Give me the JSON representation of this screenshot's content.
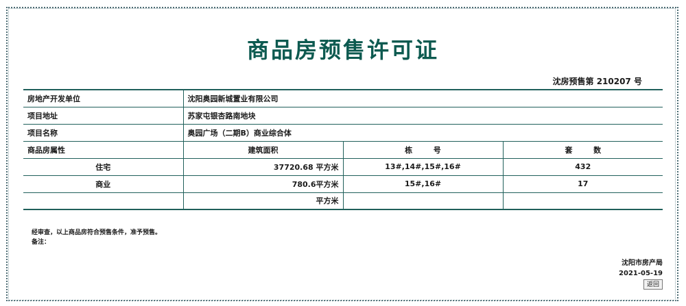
{
  "title": "商品房预售许可证",
  "permit_number": "沈房预售第  210207  号",
  "rows": {
    "developer_label": "房地产开发单位",
    "developer_value": "沈阳奥园新城置业有限公司",
    "address_label": "项目地址",
    "address_value": "苏家屯银杏路南地块",
    "name_label": "项目名称",
    "name_value": "奥园广场（二期B）商业综合体",
    "attr_label": "商品房属性",
    "area_header": "建筑面积",
    "building_header": "栋        号",
    "units_header": "套        数"
  },
  "property_rows": [
    {
      "type": "住宅",
      "area": "37720.68 平方米",
      "buildings": "13#,14#,15#,16#",
      "units": "432"
    },
    {
      "type": "商业",
      "area": "780.6平方米",
      "buildings": "15#,16#",
      "units": "17"
    },
    {
      "type": "",
      "area": "平方米",
      "buildings": "",
      "units": ""
    }
  ],
  "notes": {
    "approval": "经审查，以上商品房符合预售条件，准予预售。",
    "remarks": "备注："
  },
  "footer": {
    "issuer": "沈阳市房产局",
    "date": "2021-05-19",
    "back_button": "返回"
  }
}
